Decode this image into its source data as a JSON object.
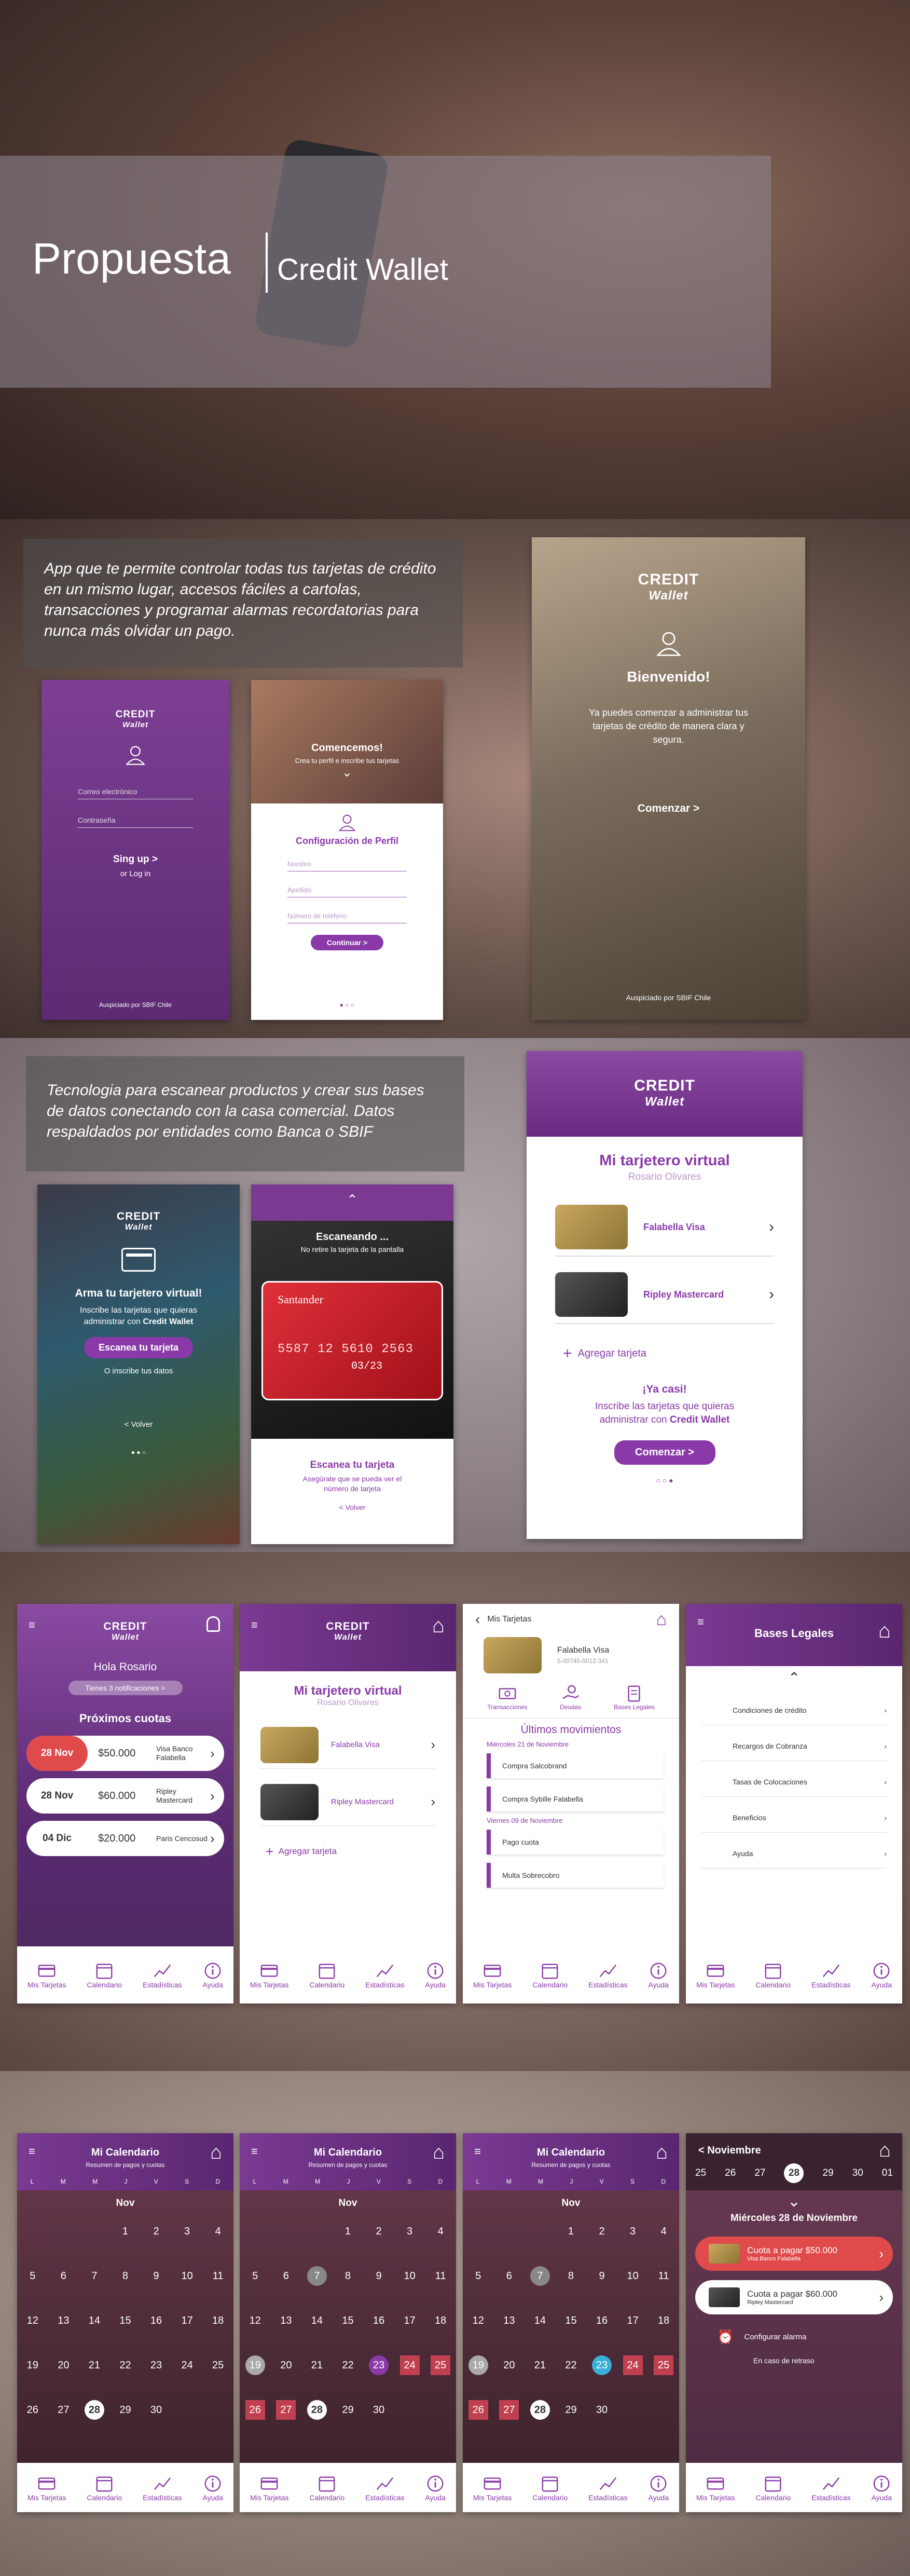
{
  "hero": {
    "title": "Propuesta",
    "subtitle": "Credit Wallet"
  },
  "brand": {
    "name": "CREDIT",
    "sub": "Wallet",
    "sponsor": "Auspiciado por SBIF Chile"
  },
  "sec2": {
    "intro": "App que te permite controlar todas tus tarjetas de crédito en un mismo lugar, accesos fáciles a cartolas, transacciones y programar alarmas recordatorias para nunca más olvidar un pago.",
    "login": {
      "email": "Correo electrónico",
      "password": "Contraseña",
      "signup": "Sing up >",
      "or_login": "or Log in",
      "sponsor": "Auspiciado por SBIF Chile"
    },
    "profile": {
      "banner_title": "Comencemos!",
      "banner_text": "Crea tu perfil e inscribe tus tarjetas",
      "title": "Configuración de Perfil",
      "f1": "Nombre",
      "f2": "Apellido",
      "f3": "Número de teléfono",
      "btn": "Continuar >"
    },
    "welcome": {
      "title": "Bienvenido!",
      "text": "Ya puedes comenzar a administrar tus tarjetas de crédito de manera clara y segura.",
      "btn": "Comenzar >",
      "sponsor": "Auspiciado por SBIF Chile"
    }
  },
  "sec3": {
    "intro": "Tecnologia para escanear productos y crear sus bases de datos conectando con la casa comercial.  Datos respaldados por entidades como Banca o SBIF",
    "arma": {
      "title": "Arma tu tarjetero virtual!",
      "text1": "Inscribe las tarjetas que quieras",
      "text2": "administrar con",
      "text2b": "Credit Wallet",
      "btn": "Escanea tu tarjeta",
      "alt": "O inscribe tus datos",
      "back": "Volver"
    },
    "scan": {
      "title": "Escaneando ...",
      "sub": "No retire la tarjeta de la pantalla",
      "bank": "Santander",
      "num": "5587 12  5610  2563",
      "exp": "03/23",
      "ctitle": "Escanea tu tarjeta",
      "ctext": "Asegúrate que se pueda ver el número de tarjeta",
      "back": "Volver"
    },
    "mi": {
      "title": "Mi tarjetero virtual",
      "name": "Rosario Olivares",
      "card1": "Falabella Visa",
      "card2": "Ripley Mastercard",
      "add": "Agregar tarjeta",
      "casi": "¡Ya casi!",
      "text": "Inscribe las tarjetas que quieras administrar con",
      "brand": "Credit Wallet",
      "btn": "Comenzar >"
    }
  },
  "nav": {
    "i1": "Mis Tarjetas",
    "i2": "Calendario",
    "i3": "Estadísticas",
    "i4": "Ayuda"
  },
  "sec4": {
    "home": {
      "greeting": "Hola Rosario",
      "notif": "Tienes 3 notificaciones  >",
      "title": "Próximos cuotas",
      "rows": [
        {
          "date": "28 Nov",
          "amount": "$50.000",
          "name": "Visa Banco Falabella"
        },
        {
          "date": "28 Nov",
          "amount": "$60.000",
          "name": "Ripley Mastercard"
        },
        {
          "date": "04 Dic",
          "amount": "$20.000",
          "name": "Paris Cencosud"
        }
      ]
    },
    "mi": {
      "title": "Mi tarjetero virtual",
      "name": "Rosario Olivares",
      "card1": "Falabella Visa",
      "card2": "Ripley Mastercard",
      "add": "Agregar tarjeta"
    },
    "det": {
      "back": "Mis Tarjetas",
      "card": "Falabella Visa",
      "num": "5-00745-0012-341",
      "a1": "Transacciones",
      "a2": "Deudas",
      "a3": "Bases Legales",
      "title": "Últimos movimientos",
      "d1": "Miércoles 21 de Noviembre",
      "m1": "Compra Salcobrand",
      "m2": "Compra Sybille Falabella",
      "d2": "Viernes 09 de Noviembre",
      "m3": "Pago cuota",
      "m4": "Multa Sobrecobro"
    },
    "bases": {
      "title": "Bases Legales",
      "items": [
        "Condiciones de crédito",
        "Recargos de Cobranza",
        "Tasas de Colocaciones",
        "Beneficios",
        "Ayuda"
      ]
    }
  },
  "sec5": {
    "cal": {
      "title": "Mi Calendario",
      "sub": "Resumen de pagos y cuotas",
      "days": [
        "L",
        "M",
        "M",
        "J",
        "V",
        "S",
        "D"
      ],
      "month": "Nov",
      "rows": [
        [
          "",
          "",
          "",
          "1",
          "2",
          "3",
          "4"
        ],
        [
          "5",
          "6",
          "7",
          "8",
          "9",
          "10",
          "11"
        ],
        [
          "12",
          "13",
          "14",
          "15",
          "16",
          "17",
          "18"
        ],
        [
          "19",
          "20",
          "21",
          "22",
          "23",
          "24",
          "25"
        ],
        [
          "26",
          "27",
          "28",
          "29",
          "30",
          "",
          ""
        ]
      ]
    },
    "nov": {
      "month": "< Noviembre",
      "week": [
        "25",
        "26",
        "27",
        "28",
        "29",
        "30",
        "01"
      ],
      "date": "Miércoles 28 de Noviembre",
      "c1": "Cuota a pagar $50.000",
      "c1s": "Visa Banco Falabella",
      "c2": "Cuota a pagar $60.000",
      "c2s": "Ripley Mastercard",
      "alarm": "Configurar alarma",
      "late": "En caso de retraso"
    }
  },
  "colors": {
    "purple": "#8a3aa8",
    "red": "#e04a4a"
  }
}
